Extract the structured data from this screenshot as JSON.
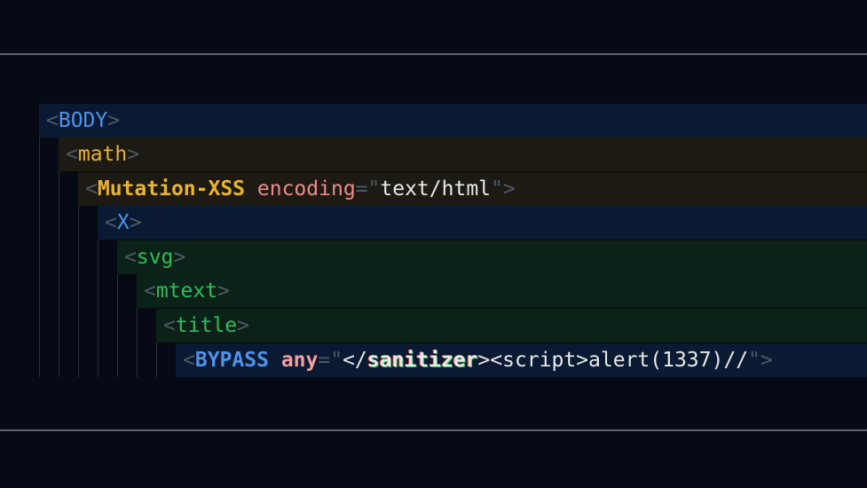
{
  "colors": {
    "background": "#060a14",
    "rule": "#5f636b",
    "tag_blue": "#4e93e8",
    "tag_gold": "#e5b42c",
    "tag_green": "#2fbe5a",
    "attribute": "#ef8a8a",
    "bracket": "#4e5866"
  },
  "lines": [
    {
      "tag": "BODY"
    },
    {
      "tag": "math"
    },
    {
      "tag": "Mutation-XSS",
      "attr": "encoding",
      "value": "text/html"
    },
    {
      "tag": "X"
    },
    {
      "tag": "svg"
    },
    {
      "tag": "mtext"
    },
    {
      "tag": "title"
    },
    {
      "tag": "BYPASS",
      "attr": "any",
      "value_pre": "</",
      "value_glitch": "sanitizer",
      "value_post": "><script>alert(1337)//"
    }
  ],
  "syntax": {
    "open": "<",
    "close": ">",
    "equals": "=",
    "quote": "\""
  }
}
